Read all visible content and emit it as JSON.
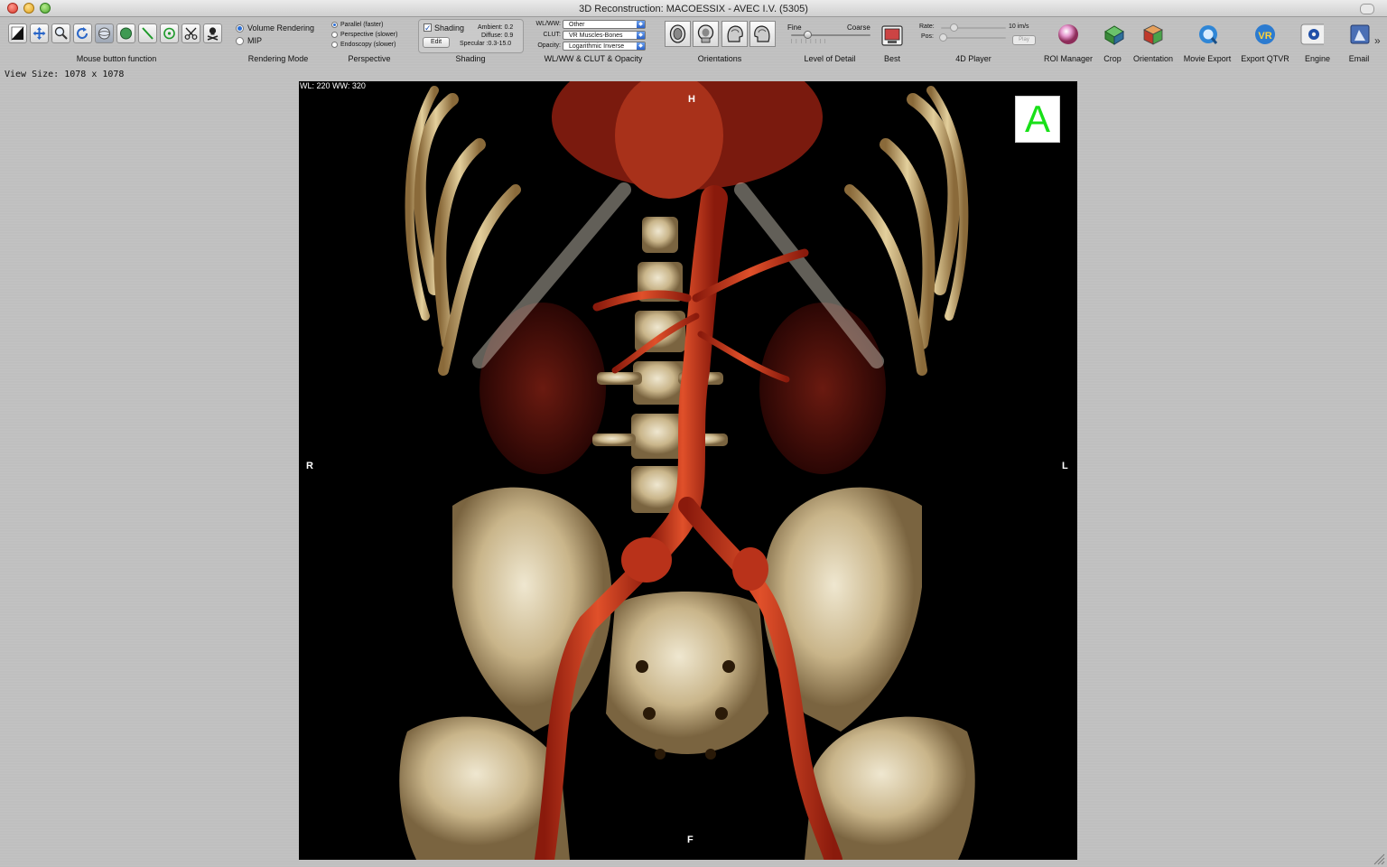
{
  "window": {
    "title": "3D Reconstruction: MACOESSIX - AVEC I.V. (5305)"
  },
  "toolbar": {
    "mouse_tools": [
      "window-level-icon",
      "move-icon",
      "zoom-icon",
      "rotate-icon",
      "camera-rotate-icon",
      "sculpt-sphere-icon",
      "length-icon",
      "point-icon",
      "scissors-icon",
      "bone-removal-icon"
    ],
    "mouse_label": "Mouse button function",
    "rendering_mode": {
      "options": [
        "Volume Rendering",
        "MIP"
      ],
      "selected": "Volume Rendering",
      "label": "Rendering Mode"
    },
    "perspective": {
      "options": [
        "Parallel (faster)",
        "Perspective (slower)",
        "Endoscopy (slower)"
      ],
      "selected": "Parallel (faster)",
      "label": "Perspective"
    },
    "shading": {
      "checkbox_label": "Shading",
      "checked": true,
      "edit_label": "Edit",
      "ambient": "Ambient: 0.2",
      "diffuse": "Diffuse: 0.9",
      "specular": "Specular :0.3-15.0",
      "label": "Shading"
    },
    "wlww_clut": {
      "wlww_label": "WL/WW:",
      "wlww_value": "Other",
      "clut_label": "CLUT:",
      "clut_value": "VR Muscles-Bones",
      "opacity_label": "Opacity:",
      "opacity_value": "Logarithmic Inverse",
      "label": "WL/WW & CLUT & Opacity"
    },
    "orientations": {
      "buttons": [
        "axial-view-icon",
        "coronal-view-icon",
        "sagittal-left-view-icon",
        "sagittal-right-view-icon"
      ],
      "label": "Orientations"
    },
    "level_of_detail": {
      "fine": "Fine",
      "coarse": "Coarse",
      "value": 0.2,
      "label": "Level of Detail"
    },
    "best": {
      "label": "Best"
    },
    "player_4d": {
      "rate_label": "Rate:",
      "rate_value": "10 im/s",
      "pos_label": "Pos:",
      "play_label": "Play",
      "label": "4D Player"
    },
    "right_buttons": [
      {
        "label": "ROI Manager",
        "icon": "roi-manager-icon"
      },
      {
        "label": "Crop",
        "icon": "crop-icon"
      },
      {
        "label": "Orientation",
        "icon": "orientation-cube-icon"
      },
      {
        "label": "Movie Export",
        "icon": "movie-export-icon"
      },
      {
        "label": "Export QTVR",
        "icon": "export-qtvr-icon"
      },
      {
        "label": "Engine",
        "icon": "engine-gear-icon"
      },
      {
        "label": "Email",
        "icon": "email-icon"
      }
    ],
    "overflow": "»"
  },
  "status": {
    "view_size": "View Size: 1078 x 1078"
  },
  "viewport": {
    "wl_ww": "WL: 220 WW: 320",
    "orientation_top": "H",
    "orientation_bottom": "F",
    "orientation_left": "R",
    "orientation_right": "L",
    "orientation_cube_letter": "A"
  }
}
